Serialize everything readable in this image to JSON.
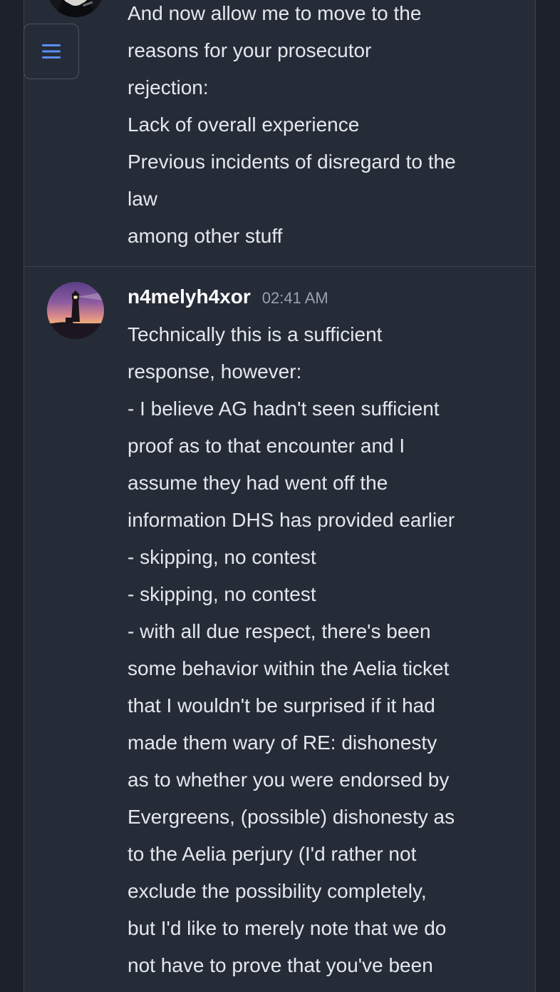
{
  "icons": {
    "menu": "hamburger-menu-icon"
  },
  "colors": {
    "background": "#1c212b",
    "panel": "#252c38",
    "text": "#e4e7eb",
    "timestamp": "#9aa1ab",
    "menu_icon": "#5a8ff0"
  },
  "messages": [
    {
      "lines": [
        "And now allow me to move to the",
        "reasons for your prosecutor",
        "rejection:",
        "Lack of overall experience",
        "Previous incidents of disregard to the",
        "law",
        "among other stuff"
      ]
    },
    {
      "author": "n4melyh4xor",
      "time": "02:41 AM",
      "lines": [
        "Technically this is a sufficient",
        "response, however:",
        "- I believe AG hadn't seen sufficient",
        "proof as to that encounter and I",
        "assume they had went off the",
        "information DHS has provided earlier",
        "- skipping, no contest",
        "- skipping, no contest",
        "- with all due respect, there's been",
        "some behavior within the Aelia ticket",
        "that I wouldn't be surprised if it had",
        "made them wary of RE: dishonesty",
        "as to whether you were endorsed by",
        "Evergreens, (possible) dishonesty as",
        "to the Aelia perjury (I'd rather not",
        "exclude the possibility completely,",
        "but I'd like to merely note that we do",
        "not have to prove that you've been"
      ]
    }
  ]
}
